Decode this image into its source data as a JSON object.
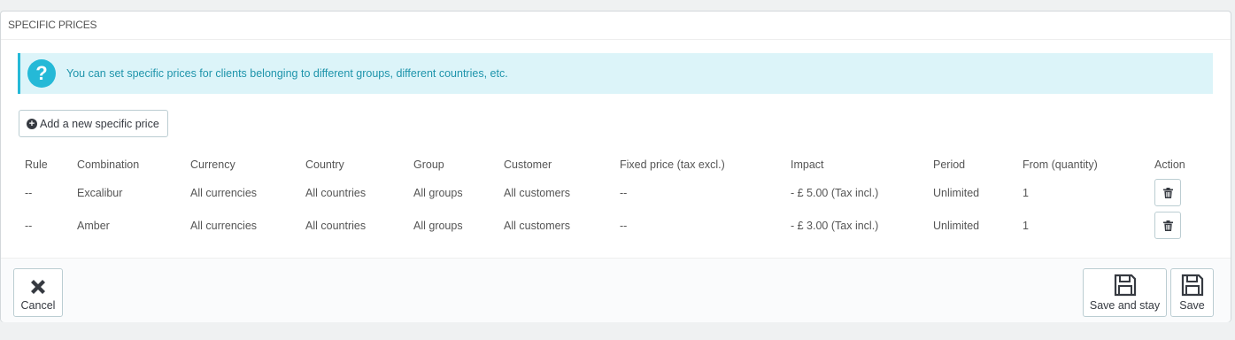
{
  "panel": {
    "title": "SPECIFIC PRICES"
  },
  "alert": {
    "text": "You can set specific prices for clients belonging to different groups, different countries, etc.",
    "icon": "question-icon"
  },
  "add_button": {
    "label": "Add a new specific price",
    "icon": "plus-circle-icon"
  },
  "table": {
    "headers": [
      "Rule",
      "Combination",
      "Currency",
      "Country",
      "Group",
      "Customer",
      "Fixed price (tax excl.)",
      "Impact",
      "Period",
      "From (quantity)",
      "Action"
    ],
    "rows": [
      [
        "--",
        "Excalibur",
        "All currencies",
        "All countries",
        "All groups",
        "All customers",
        "--",
        "- £ 5.00 (Tax incl.)",
        "Unlimited",
        "1"
      ],
      [
        "--",
        "Amber",
        "All currencies",
        "All countries",
        "All groups",
        "All customers",
        "--",
        "- £ 3.00 (Tax incl.)",
        "Unlimited",
        "1"
      ]
    ]
  },
  "footer": {
    "cancel_label": "Cancel",
    "save_and_stay_label": "Save and stay",
    "save_label": "Save"
  },
  "colors": {
    "info_bg": "#dcf4f9",
    "info_accent": "#25b9d7",
    "info_text": "#1e94ab"
  }
}
